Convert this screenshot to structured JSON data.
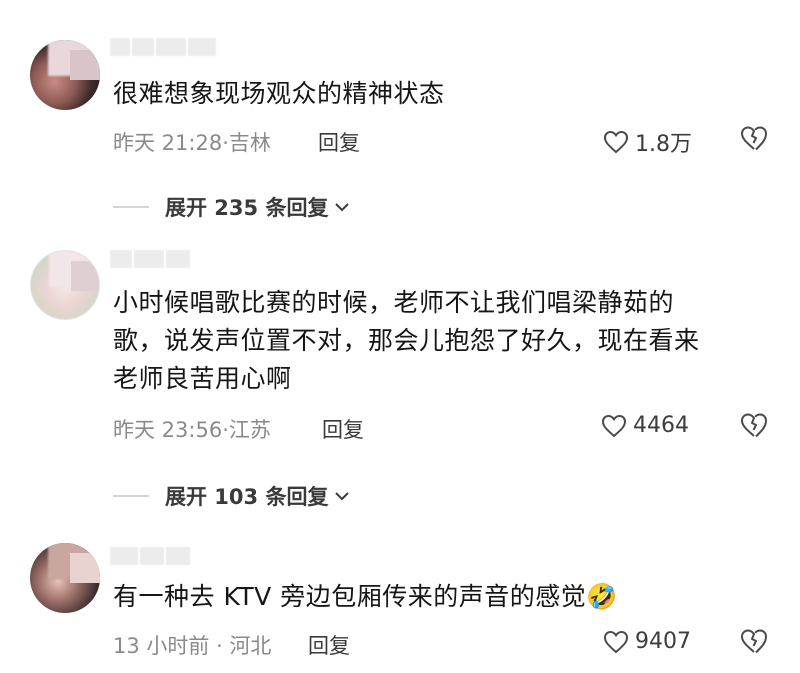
{
  "comments": [
    {
      "text_lines": [
        "很难想象现场观众的精神状态"
      ],
      "meta": "昨天 21:28·吉林",
      "reply": "回复",
      "likes": "1.8万",
      "expand": "展开 235 条回复"
    },
    {
      "text_lines": [
        "小时候唱歌比赛的时候，老师不让我们唱梁静茹的",
        "歌，说发声位置不对，那会儿抱怨了好久，现在看来",
        "老师良苦用心啊"
      ],
      "meta": "昨天 23:56·江苏",
      "reply": "回复",
      "likes": "4464",
      "expand": "展开 103 条回复"
    },
    {
      "text_lines": [
        "有一种去 KTV 旁边包厢传来的声音的感觉🤣"
      ],
      "meta": "13 小时前 · 河北",
      "reply": "回复",
      "likes": "9407"
    }
  ],
  "icons": {
    "like": "heart-outline-icon",
    "dislike": "broken-heart-icon",
    "expand": "chevron-down-icon"
  },
  "colors": {
    "text": "#161616",
    "meta": "#8a8a8a",
    "icon": "#3c3c3c"
  }
}
